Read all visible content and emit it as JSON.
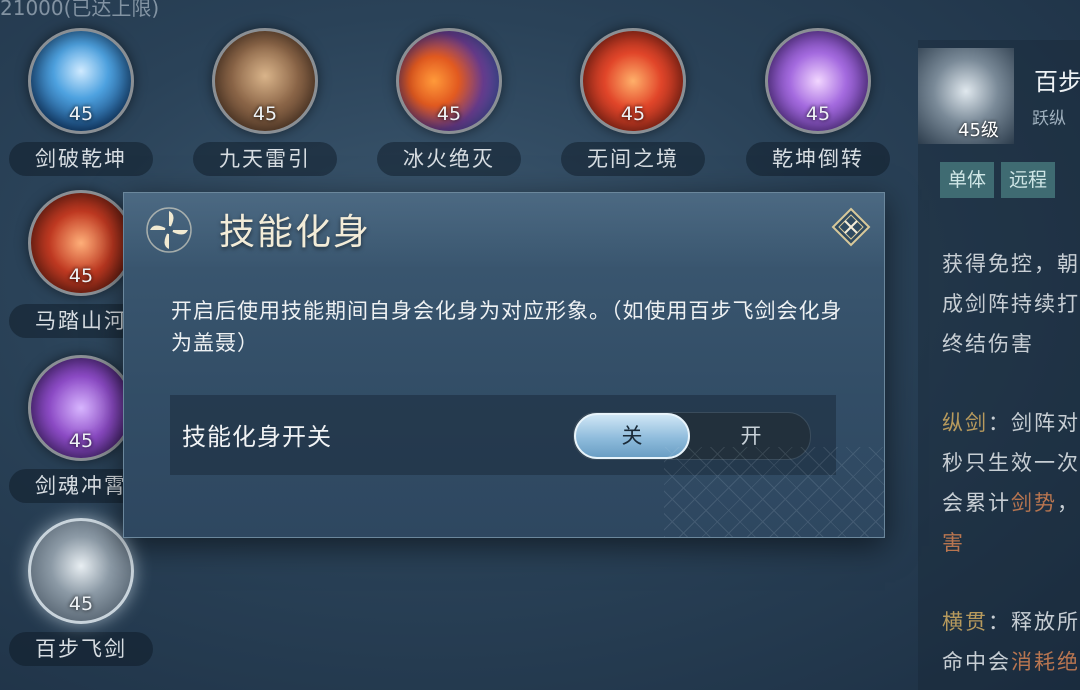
{
  "top_hint": "21000(已达上限)",
  "skills": [
    {
      "name": "剑破乾坤",
      "level": "45"
    },
    {
      "name": "九天雷引",
      "level": "45"
    },
    {
      "name": "冰火绝灭",
      "level": "45"
    },
    {
      "name": "无间之境",
      "level": "45"
    },
    {
      "name": "乾坤倒转",
      "level": "45"
    },
    {
      "name": "马踏山河",
      "level": "45"
    },
    {
      "name": "剑魂冲霄",
      "level": "45"
    },
    {
      "name": "百步飞剑",
      "level": "45"
    }
  ],
  "detail": {
    "title": "百步",
    "subtitle": "跃纵",
    "level": "45级",
    "tags": [
      "单体",
      "远程"
    ],
    "lines": [
      {
        "text": "获得免控，朝"
      },
      {
        "text": "成剑阵持续打"
      },
      {
        "text": "终结伤害"
      },
      {
        "prefix": "纵剑",
        "text": "：剑阵对"
      },
      {
        "text": "秒只生效一次"
      },
      {
        "text": "会累计",
        "accent": "剑势",
        "tail": "，"
      },
      {
        "text": "害"
      },
      {
        "prefix": "横贯",
        "text": "：释放所"
      },
      {
        "text": "命中会",
        "accent": "消耗绝"
      }
    ]
  },
  "modal": {
    "title": "技能化身",
    "description": "开启后使用技能期间自身会化身为对应形象。（如使用百步飞剑会化身为盖聂）",
    "toggle_label": "技能化身开关",
    "toggle_off": "关",
    "toggle_on": "开",
    "state": "off"
  },
  "colors": {
    "accent_gold": "#b79a5d",
    "accent_warm": "#b87550",
    "toggle_selected": "#8fbcdc"
  }
}
